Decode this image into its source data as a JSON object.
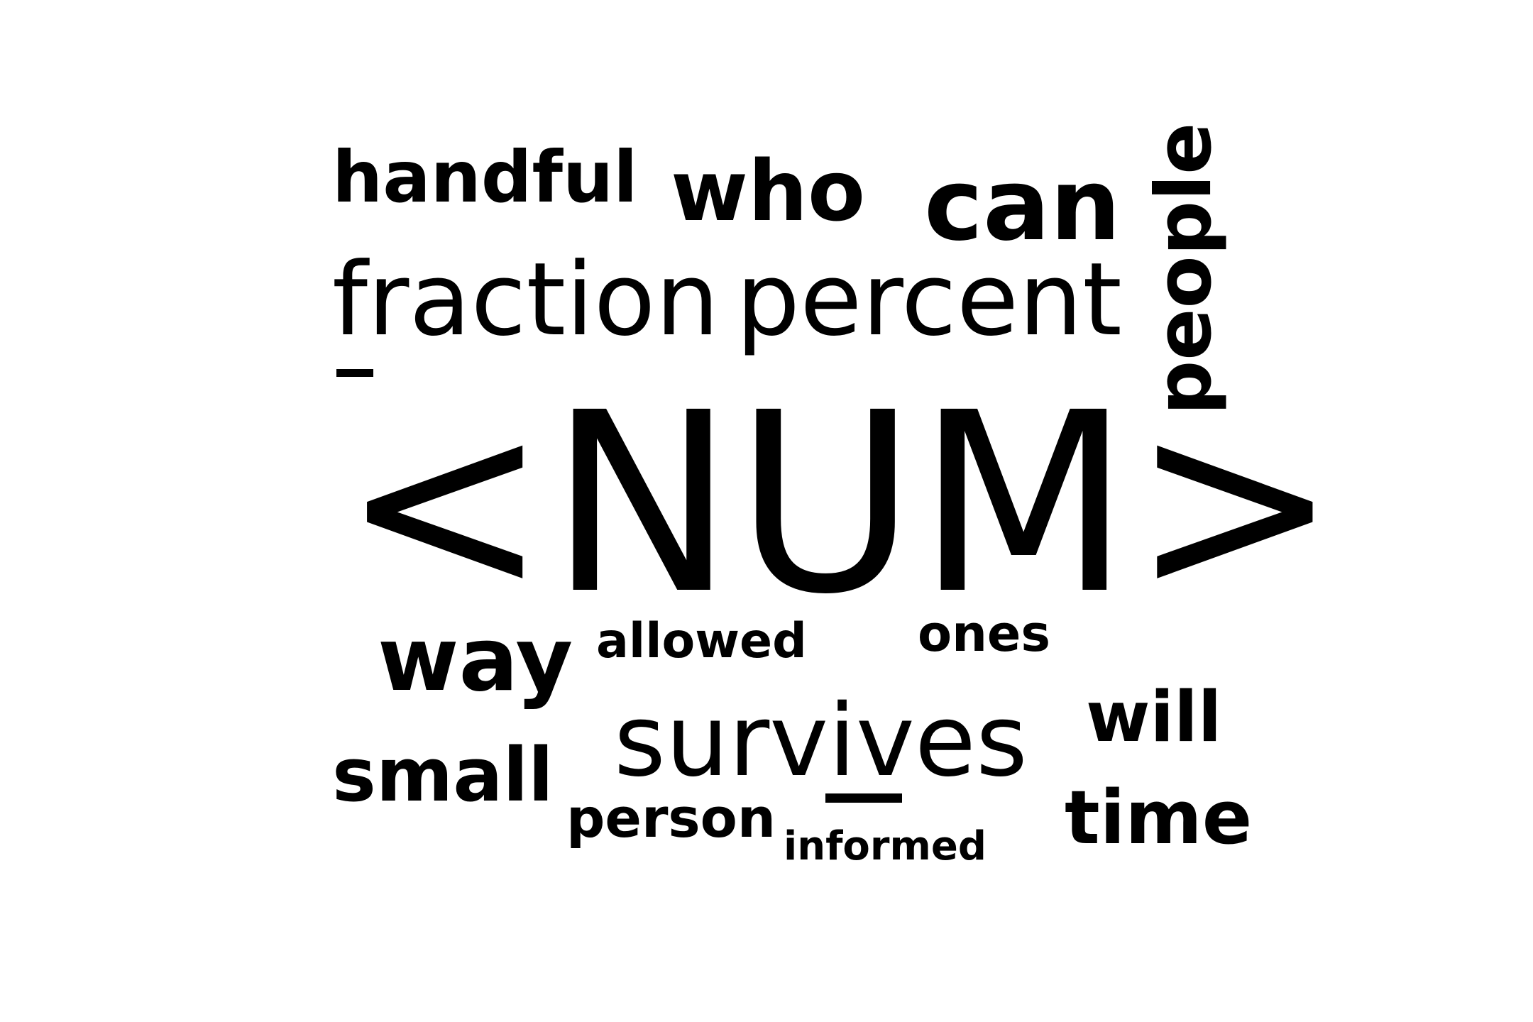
{
  "word_cloud": {
    "words": [
      {
        "key": "handful",
        "text": "handful"
      },
      {
        "key": "who",
        "text": "who"
      },
      {
        "key": "can",
        "text": "can"
      },
      {
        "key": "fraction",
        "text": "fraction"
      },
      {
        "key": "percent",
        "text": "percent"
      },
      {
        "key": "people",
        "text": "people"
      },
      {
        "key": "num",
        "text": "<NUM>"
      },
      {
        "key": "way",
        "text": "way"
      },
      {
        "key": "allowed",
        "text": "allowed"
      },
      {
        "key": "ones",
        "text": "ones"
      },
      {
        "key": "survives",
        "text": "survives"
      },
      {
        "key": "will",
        "text": "will"
      },
      {
        "key": "small",
        "text": "small"
      },
      {
        "key": "person",
        "text": "person"
      },
      {
        "key": "informed",
        "text": "informed"
      },
      {
        "key": "time",
        "text": "time"
      }
    ],
    "colors": {
      "background": "#ffffff",
      "text": "#000000"
    }
  }
}
